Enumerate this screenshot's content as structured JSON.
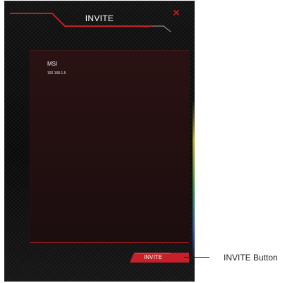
{
  "window": {
    "title": "INVITE",
    "close_icon": "close-icon",
    "close_glyph": "✕"
  },
  "device_list": {
    "items": [
      {
        "name": "MSI",
        "ip": "192.168.1.5"
      }
    ]
  },
  "actions": {
    "invite_label": "INVITE"
  },
  "annotation": {
    "label": "INVITE Button"
  },
  "colors": {
    "accent_red": "#d3232a",
    "background": "#0e0e0e",
    "panel": "#241011"
  }
}
